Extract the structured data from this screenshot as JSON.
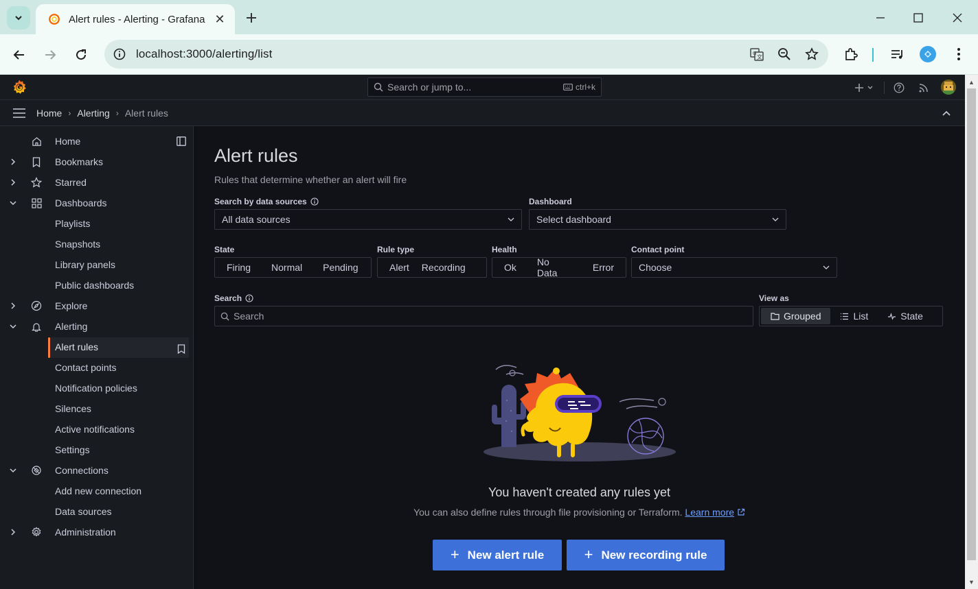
{
  "browser": {
    "tab_title": "Alert rules - Alerting - Grafana",
    "url": "localhost:3000/alerting/list"
  },
  "topbar": {
    "search_placeholder": "Search or jump to...",
    "search_shortcut": "ctrl+k"
  },
  "breadcrumb": [
    "Home",
    "Alerting",
    "Alert rules"
  ],
  "sidebar": {
    "items": [
      {
        "label": "Home",
        "icon": "home-icon",
        "level": 0
      },
      {
        "label": "Bookmarks",
        "icon": "bookmark-icon",
        "level": 0,
        "chevron": "right"
      },
      {
        "label": "Starred",
        "icon": "star-icon",
        "level": 0,
        "chevron": "right"
      },
      {
        "label": "Dashboards",
        "icon": "apps-icon",
        "level": 0,
        "chevron": "down"
      },
      {
        "label": "Playlists",
        "level": 1
      },
      {
        "label": "Snapshots",
        "level": 1
      },
      {
        "label": "Library panels",
        "level": 1
      },
      {
        "label": "Public dashboards",
        "level": 1
      },
      {
        "label": "Explore",
        "icon": "compass-icon",
        "level": 0,
        "chevron": "right"
      },
      {
        "label": "Alerting",
        "icon": "bell-icon",
        "level": 0,
        "chevron": "down"
      },
      {
        "label": "Alert rules",
        "level": 1,
        "active": true
      },
      {
        "label": "Contact points",
        "level": 1
      },
      {
        "label": "Notification policies",
        "level": 1
      },
      {
        "label": "Silences",
        "level": 1
      },
      {
        "label": "Active notifications",
        "level": 1
      },
      {
        "label": "Settings",
        "level": 1
      },
      {
        "label": "Connections",
        "icon": "connections-icon",
        "level": 0,
        "chevron": "down"
      },
      {
        "label": "Add new connection",
        "level": 1
      },
      {
        "label": "Data sources",
        "level": 1
      },
      {
        "label": "Administration",
        "icon": "cog-icon",
        "level": 0,
        "chevron": "right"
      }
    ]
  },
  "page": {
    "title": "Alert rules",
    "subtitle": "Rules that determine whether an alert will fire"
  },
  "filters": {
    "datasource_label": "Search by data sources",
    "datasource_value": "All data sources",
    "dashboard_label": "Dashboard",
    "dashboard_value": "Select dashboard",
    "state_label": "State",
    "state_options": [
      "Firing",
      "Normal",
      "Pending"
    ],
    "ruletype_label": "Rule type",
    "ruletype_options": [
      "Alert",
      "Recording"
    ],
    "health_label": "Health",
    "health_options": [
      "Ok",
      "No Data",
      "Error"
    ],
    "contact_label": "Contact point",
    "contact_value": "Choose",
    "search_label": "Search",
    "search_placeholder": "Search",
    "viewas_label": "View as",
    "viewas_options": [
      "Grouped",
      "List",
      "State"
    ],
    "viewas_selected": "Grouped"
  },
  "empty": {
    "title": "You haven't created any rules yet",
    "text": "You can also define rules through file provisioning or Terraform.",
    "link": "Learn more",
    "btn_alert": "New alert rule",
    "btn_recording": "New recording rule"
  },
  "colors": {
    "accent": "#ff7d3f",
    "primary_button": "#3d71d9",
    "link": "#6e9fff"
  }
}
